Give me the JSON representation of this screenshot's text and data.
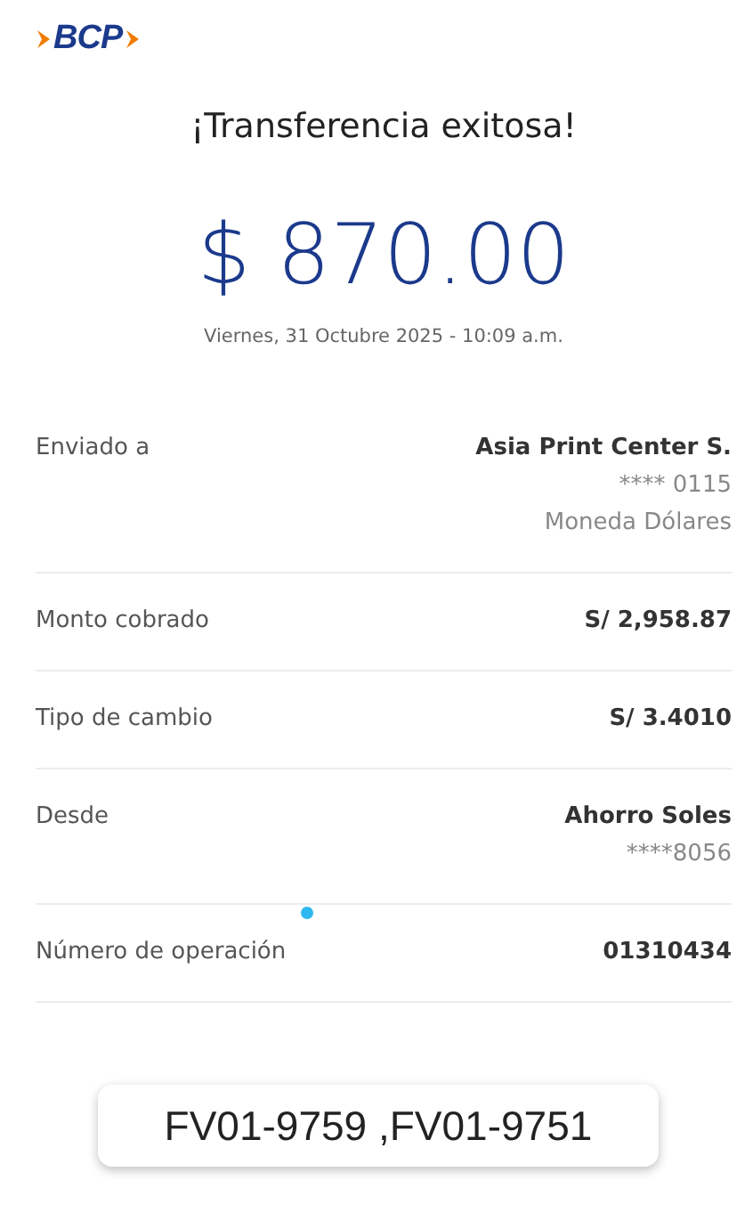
{
  "logo": {
    "text": "BCP"
  },
  "title": "¡Transferencia exitosa!",
  "amount": "$ 870.00",
  "date": "Viernes, 31 Octubre 2025 - 10:09 a.m.",
  "details": [
    {
      "label": "Enviado a",
      "lines": [
        {
          "text": "Asia Print Center S.",
          "bold": true
        },
        {
          "text": "**** 0115",
          "bold": false
        },
        {
          "text": "Moneda Dólares",
          "bold": false
        }
      ]
    },
    {
      "label": "Monto cobrado",
      "lines": [
        {
          "text": "S/ 2,958.87",
          "bold": true
        }
      ]
    },
    {
      "label": "Tipo de cambio",
      "lines": [
        {
          "text": "S/ 3.4010",
          "bold": true
        }
      ]
    },
    {
      "label": "Desde",
      "lines": [
        {
          "text": "Ahorro Soles",
          "bold": true
        },
        {
          "text": "****8056",
          "bold": false
        }
      ]
    },
    {
      "label": "Número de operación",
      "lines": [
        {
          "text": "01310434",
          "bold": true
        }
      ]
    }
  ],
  "note": "FV01-9759 ,FV01-9751"
}
